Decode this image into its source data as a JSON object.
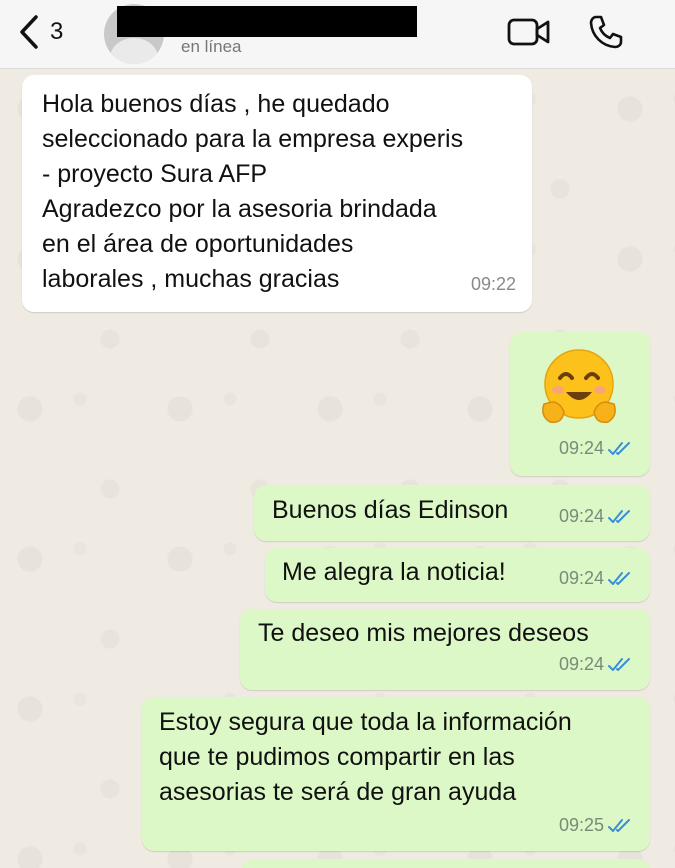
{
  "header": {
    "back_count": "3",
    "status": "en línea",
    "icons": {
      "back": "chevron-left-icon",
      "video": "video-call-icon",
      "phone": "phone-icon"
    }
  },
  "messages": [
    {
      "dir": "in",
      "text": "Hola buenos días , he quedado\nseleccionado para la empresa experis\n- proyecto Sura AFP\nAgradezco por la asesoria brindada\nen el área de oportunidades\nlaborales , muchas gracias",
      "time": "09:22"
    },
    {
      "dir": "out",
      "emoji": "hugging-face-emoji",
      "time": "09:24",
      "read": true
    },
    {
      "dir": "out",
      "text": "Buenos días Edinson",
      "time": "09:24",
      "read": true
    },
    {
      "dir": "out",
      "text": "Me alegra la noticia!",
      "time": "09:24",
      "read": true
    },
    {
      "dir": "out",
      "text": "Te deseo mis mejores deseos",
      "time": "09:24",
      "read": true
    },
    {
      "dir": "out",
      "text": "Estoy segura que toda la información\nque te pudimos compartir en las\nasesorias te será de gran ayuda",
      "time": "09:25",
      "read": true
    }
  ],
  "colors": {
    "incoming": "#ffffff",
    "outgoing": "#dcf8c6",
    "read_ticks": "#3b8ed6",
    "chat_bg": "#efeae2"
  }
}
